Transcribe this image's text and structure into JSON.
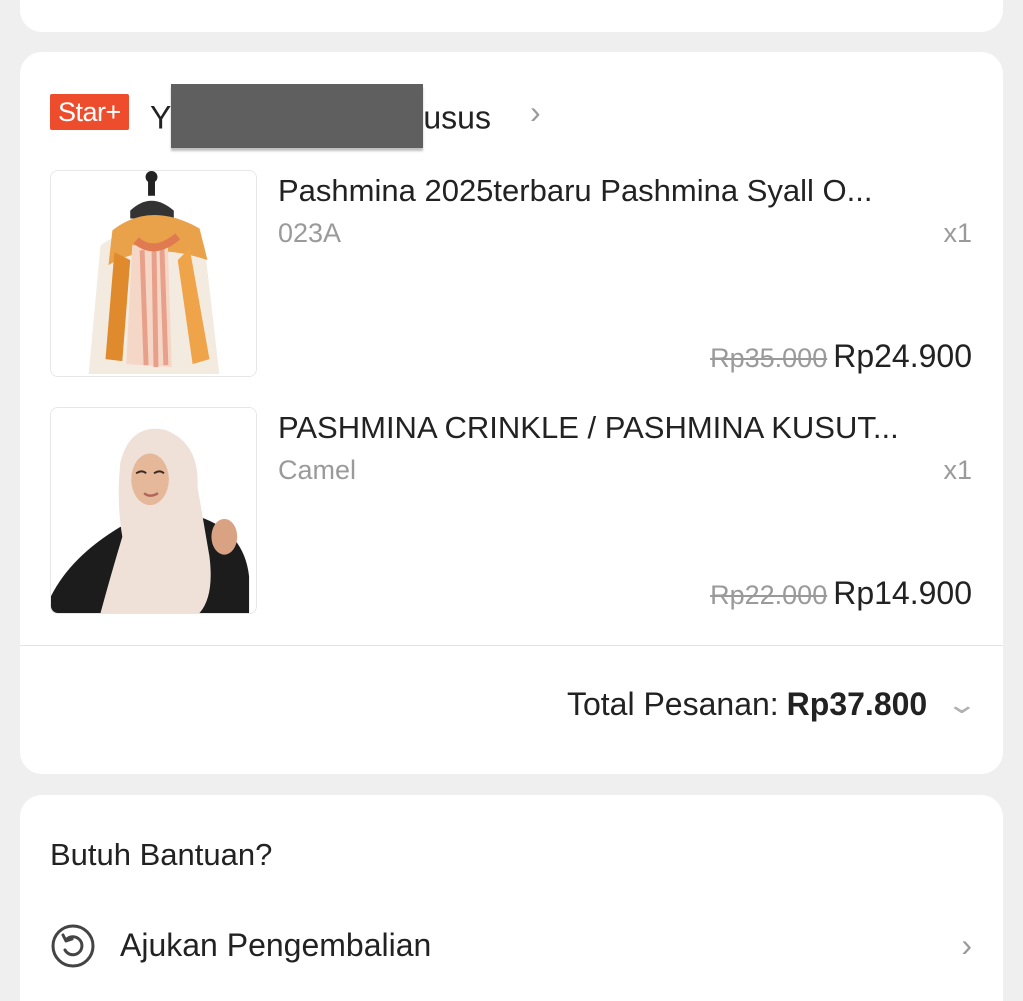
{
  "shop": {
    "badge": "Star+",
    "name_prefix": "Y",
    "name_suffix": "usus",
    "chevron": "›"
  },
  "items": [
    {
      "title": "Pashmina 2025terbaru Pashmina Syall O...",
      "variant": "023A",
      "qty": "x1",
      "price_original": "Rp35.000",
      "price_final": "Rp24.900",
      "image": "scarf-on-mannequin"
    },
    {
      "title": "PASHMINA CRINKLE / PASHMINA KUSUT...",
      "variant": "Camel",
      "qty": "x1",
      "price_original": "Rp22.000",
      "price_final": "Rp14.900",
      "image": "woman-in-hijab"
    }
  ],
  "total": {
    "label": "Total Pesanan:",
    "value": "Rp37.800"
  },
  "help": {
    "title": "Butuh Bantuan?",
    "items": [
      {
        "label": "Ajukan Pengembalian",
        "icon": "return-icon"
      }
    ]
  },
  "colors": {
    "badge": "#ee4d2d",
    "background": "#efefef",
    "card": "#ffffff",
    "muted_text": "#9a9a9a"
  }
}
